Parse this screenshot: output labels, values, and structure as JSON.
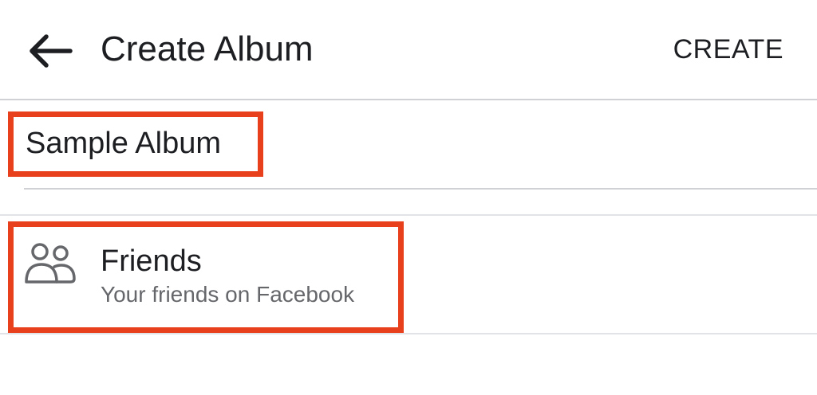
{
  "header": {
    "back_icon": "arrow-left-icon",
    "title": "Create Album",
    "create_label": "CREATE"
  },
  "album_form": {
    "name_value": "Sample Album"
  },
  "privacy": {
    "icon": "friends-icon",
    "title": "Friends",
    "subtitle": "Your friends on Facebook"
  },
  "colors": {
    "highlight": "#e8401c",
    "text_primary": "#1c1e21",
    "text_secondary": "#65676b",
    "divider": "#cfd1d5"
  }
}
